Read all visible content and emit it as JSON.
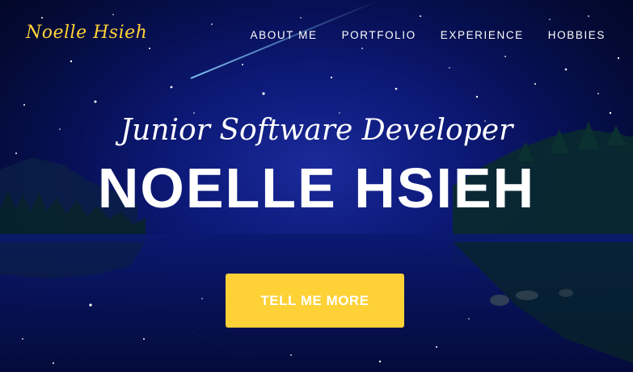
{
  "navbar": {
    "brand": "Noelle Hsieh",
    "links": [
      {
        "label": "ABOUT ME"
      },
      {
        "label": "PORTFOLIO"
      },
      {
        "label": "EXPERIENCE"
      },
      {
        "label": "HOBBIES"
      }
    ]
  },
  "hero": {
    "lead_in": "Junior Software Developer",
    "heading": "NOELLE HSIEH",
    "cta_label": "TELL ME MORE",
    "background": "night-sky-lake-image"
  },
  "colors": {
    "accent": "#fed136",
    "text": "#ffffff",
    "sky_dark": "#030a33",
    "sky_mid": "#0d1a7a"
  }
}
